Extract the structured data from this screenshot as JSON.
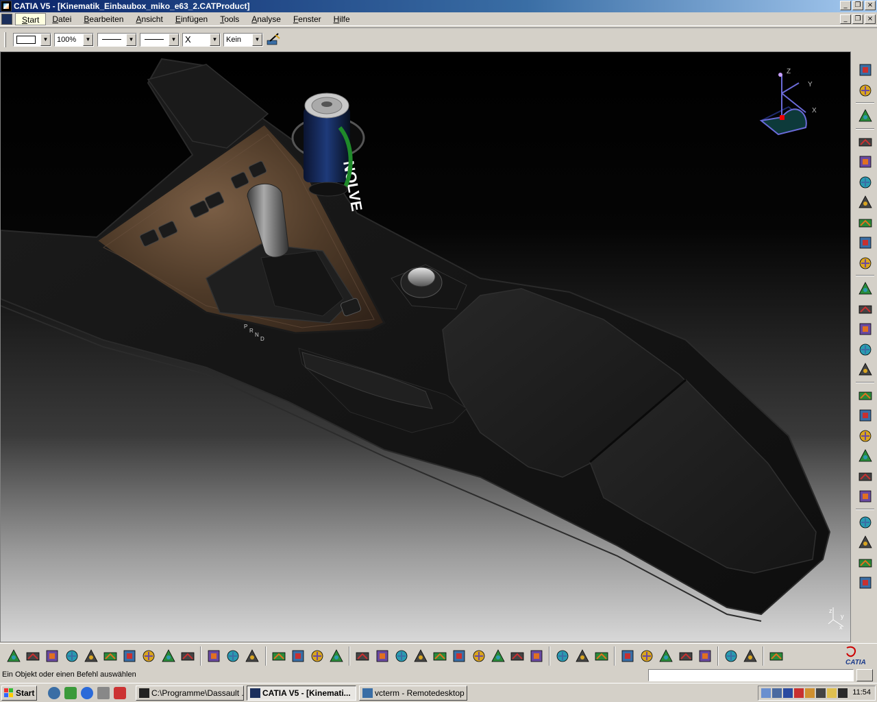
{
  "window": {
    "title": "CATIA V5 - [Kinematik_Einbaubox_miko_e63_2.CATProduct]"
  },
  "menu": {
    "items": [
      "Start",
      "Datei",
      "Bearbeiten",
      "Ansicht",
      "Einfügen",
      "Tools",
      "Analyse",
      "Fenster",
      "Hilfe"
    ],
    "underline_letters": [
      "S",
      "D",
      "B",
      "A",
      "E",
      "T",
      "A",
      "F",
      "H"
    ]
  },
  "format_toolbar": {
    "zoom": "100%",
    "point_style": "X",
    "layer": "Kein"
  },
  "compass": {
    "z_label": "Z",
    "y_label": "Y",
    "x_label": "X"
  },
  "mini_axes": {
    "y": "y",
    "z": "z",
    "x": "x"
  },
  "can_brand_text": "NOLVE",
  "shifter_labels": [
    "P",
    "R",
    "N",
    "D"
  ],
  "status": {
    "text": "Ein Objekt oder einen Befehl auswählen"
  },
  "taskbar": {
    "start_label": "Start",
    "tasks": [
      {
        "label": "C:\\Programme\\Dassault ...",
        "active": false
      },
      {
        "label": "CATIA V5 - [Kinemati...",
        "active": true
      },
      {
        "label": "vcterm - Remotedesktop",
        "active": false
      }
    ],
    "clock": "11:54"
  },
  "colors": {
    "titlebar_start": "#0a246a",
    "titlebar_end": "#a6caf0",
    "ui_face": "#d4d0c8",
    "viewport_top": "#000000",
    "viewport_bottom": "#d8d8d8",
    "wood_trim": "#5a4330"
  },
  "right_toolbar_icons": [
    "fly-mode-icon",
    "select-icon",
    "manipulate-icon",
    "2d-view-icon",
    "multi-view-icon",
    "snap-icon",
    "text-icon",
    "sphere-icon",
    "book-icon",
    "analysis-icon",
    "film-icon",
    "assembly-icon",
    "tree-icon",
    "cube-icon",
    "constraints-icon",
    "binoculars-icon",
    "network-icon",
    "catalog-icon",
    "measure-icon",
    "document-icon",
    "report-icon",
    "update-icon",
    "compare-icon",
    "geometry-icon",
    "settings-icon"
  ],
  "bottom_toolbar_icons": [
    "new-icon",
    "open-icon",
    "save-icon",
    "print-icon",
    "cut-icon",
    "copy-icon",
    "paste-icon",
    "undo-icon",
    "redo-icon",
    "whats-this-icon",
    "formula-icon",
    "comment-icon",
    "light-icon",
    "table-icon",
    "lock-icon",
    "filter-icon",
    "fly-icon",
    "fit-all-icon",
    "pan-icon",
    "rotate-icon",
    "zoom-in-icon",
    "zoom-out-icon",
    "normal-view-icon",
    "iso-view-icon",
    "shading-icon",
    "hide-show-icon",
    "swap-icon",
    "compass-down-icon",
    "compass-up-icon",
    "measure-icon",
    "target-icon",
    "prev-icon",
    "next-icon",
    "search-icon",
    "tools-icon",
    "palette-icon",
    "highlight-icon",
    "resize-icon"
  ]
}
